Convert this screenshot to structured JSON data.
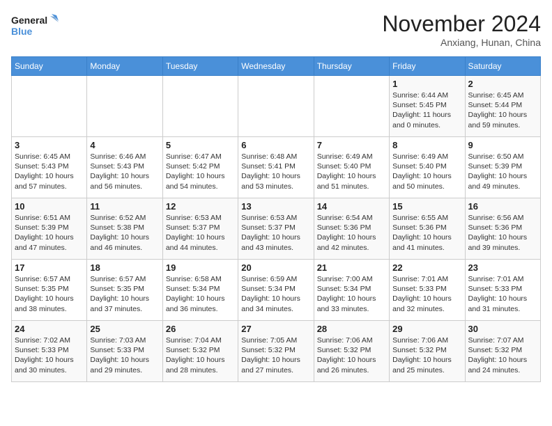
{
  "header": {
    "logo_line1": "General",
    "logo_line2": "Blue",
    "month_title": "November 2024",
    "location": "Anxiang, Hunan, China"
  },
  "calendar": {
    "days_of_week": [
      "Sunday",
      "Monday",
      "Tuesday",
      "Wednesday",
      "Thursday",
      "Friday",
      "Saturday"
    ],
    "weeks": [
      [
        {
          "day": "",
          "info": ""
        },
        {
          "day": "",
          "info": ""
        },
        {
          "day": "",
          "info": ""
        },
        {
          "day": "",
          "info": ""
        },
        {
          "day": "",
          "info": ""
        },
        {
          "day": "1",
          "info": "Sunrise: 6:44 AM\nSunset: 5:45 PM\nDaylight: 11 hours\nand 0 minutes."
        },
        {
          "day": "2",
          "info": "Sunrise: 6:45 AM\nSunset: 5:44 PM\nDaylight: 10 hours\nand 59 minutes."
        }
      ],
      [
        {
          "day": "3",
          "info": "Sunrise: 6:45 AM\nSunset: 5:43 PM\nDaylight: 10 hours\nand 57 minutes."
        },
        {
          "day": "4",
          "info": "Sunrise: 6:46 AM\nSunset: 5:43 PM\nDaylight: 10 hours\nand 56 minutes."
        },
        {
          "day": "5",
          "info": "Sunrise: 6:47 AM\nSunset: 5:42 PM\nDaylight: 10 hours\nand 54 minutes."
        },
        {
          "day": "6",
          "info": "Sunrise: 6:48 AM\nSunset: 5:41 PM\nDaylight: 10 hours\nand 53 minutes."
        },
        {
          "day": "7",
          "info": "Sunrise: 6:49 AM\nSunset: 5:40 PM\nDaylight: 10 hours\nand 51 minutes."
        },
        {
          "day": "8",
          "info": "Sunrise: 6:49 AM\nSunset: 5:40 PM\nDaylight: 10 hours\nand 50 minutes."
        },
        {
          "day": "9",
          "info": "Sunrise: 6:50 AM\nSunset: 5:39 PM\nDaylight: 10 hours\nand 49 minutes."
        }
      ],
      [
        {
          "day": "10",
          "info": "Sunrise: 6:51 AM\nSunset: 5:39 PM\nDaylight: 10 hours\nand 47 minutes."
        },
        {
          "day": "11",
          "info": "Sunrise: 6:52 AM\nSunset: 5:38 PM\nDaylight: 10 hours\nand 46 minutes."
        },
        {
          "day": "12",
          "info": "Sunrise: 6:53 AM\nSunset: 5:37 PM\nDaylight: 10 hours\nand 44 minutes."
        },
        {
          "day": "13",
          "info": "Sunrise: 6:53 AM\nSunset: 5:37 PM\nDaylight: 10 hours\nand 43 minutes."
        },
        {
          "day": "14",
          "info": "Sunrise: 6:54 AM\nSunset: 5:36 PM\nDaylight: 10 hours\nand 42 minutes."
        },
        {
          "day": "15",
          "info": "Sunrise: 6:55 AM\nSunset: 5:36 PM\nDaylight: 10 hours\nand 41 minutes."
        },
        {
          "day": "16",
          "info": "Sunrise: 6:56 AM\nSunset: 5:36 PM\nDaylight: 10 hours\nand 39 minutes."
        }
      ],
      [
        {
          "day": "17",
          "info": "Sunrise: 6:57 AM\nSunset: 5:35 PM\nDaylight: 10 hours\nand 38 minutes."
        },
        {
          "day": "18",
          "info": "Sunrise: 6:57 AM\nSunset: 5:35 PM\nDaylight: 10 hours\nand 37 minutes."
        },
        {
          "day": "19",
          "info": "Sunrise: 6:58 AM\nSunset: 5:34 PM\nDaylight: 10 hours\nand 36 minutes."
        },
        {
          "day": "20",
          "info": "Sunrise: 6:59 AM\nSunset: 5:34 PM\nDaylight: 10 hours\nand 34 minutes."
        },
        {
          "day": "21",
          "info": "Sunrise: 7:00 AM\nSunset: 5:34 PM\nDaylight: 10 hours\nand 33 minutes."
        },
        {
          "day": "22",
          "info": "Sunrise: 7:01 AM\nSunset: 5:33 PM\nDaylight: 10 hours\nand 32 minutes."
        },
        {
          "day": "23",
          "info": "Sunrise: 7:01 AM\nSunset: 5:33 PM\nDaylight: 10 hours\nand 31 minutes."
        }
      ],
      [
        {
          "day": "24",
          "info": "Sunrise: 7:02 AM\nSunset: 5:33 PM\nDaylight: 10 hours\nand 30 minutes."
        },
        {
          "day": "25",
          "info": "Sunrise: 7:03 AM\nSunset: 5:33 PM\nDaylight: 10 hours\nand 29 minutes."
        },
        {
          "day": "26",
          "info": "Sunrise: 7:04 AM\nSunset: 5:32 PM\nDaylight: 10 hours\nand 28 minutes."
        },
        {
          "day": "27",
          "info": "Sunrise: 7:05 AM\nSunset: 5:32 PM\nDaylight: 10 hours\nand 27 minutes."
        },
        {
          "day": "28",
          "info": "Sunrise: 7:06 AM\nSunset: 5:32 PM\nDaylight: 10 hours\nand 26 minutes."
        },
        {
          "day": "29",
          "info": "Sunrise: 7:06 AM\nSunset: 5:32 PM\nDaylight: 10 hours\nand 25 minutes."
        },
        {
          "day": "30",
          "info": "Sunrise: 7:07 AM\nSunset: 5:32 PM\nDaylight: 10 hours\nand 24 minutes."
        }
      ]
    ]
  }
}
